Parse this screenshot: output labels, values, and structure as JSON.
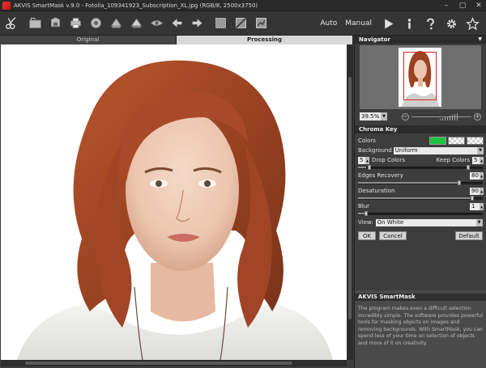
{
  "window": {
    "title": "AKVIS SmartMask v.9.0 - Fotolia_109341923_Subscription_XL.jpg (RGB/8, 2500x3750)",
    "minimize": "–",
    "maximize": "▢",
    "close": "✕"
  },
  "toolbar": {
    "auto_label": "Auto",
    "manual_label": "Manual"
  },
  "tabs": [
    {
      "label": "Original",
      "active": false
    },
    {
      "label": "Processing",
      "active": true
    }
  ],
  "navigator": {
    "title": "Navigator",
    "zoom_value": "39.5%",
    "zoom_minus": "−",
    "zoom_plus": "+"
  },
  "chroma_key": {
    "title": "Chroma Key",
    "colors_label": "Colors",
    "background_label": "Background",
    "background_value": "Uniform",
    "drop_colors_value": "5",
    "drop_colors_label": "Drop Colors",
    "keep_colors_label": "Keep Colors",
    "keep_colors_value": "5",
    "edges_recovery_label": "Edges Recovery",
    "edges_recovery_value": "80",
    "desaturation_label": "Desaturation",
    "desaturation_value": "90",
    "blur_label": "Blur",
    "blur_value": "1",
    "view_label": "View:",
    "view_value": "On White",
    "ok_label": "OK",
    "cancel_label": "Cancel",
    "default_label": "Default",
    "accent_color": "#1cc13c"
  },
  "info": {
    "title": "AKVIS SmartMask",
    "text": "The program makes even a difficult selection incredibly simple. The software provides powerful tools for masking objects on images and removing backgrounds. With SmartMask, you can spend less of your time on selection of objects and more of it on creativity."
  }
}
